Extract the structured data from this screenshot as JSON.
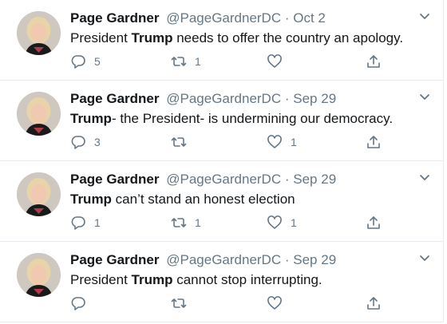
{
  "tweets": [
    {
      "name": "Page Gardner",
      "handle": "@PageGardnerDC",
      "separator": "·",
      "date": "Oct 2",
      "text_before": "President ",
      "text_bold": "Trump",
      "text_after": " needs to offer the country an apology.",
      "replies": "5",
      "retweets": "1",
      "likes": ""
    },
    {
      "name": "Page Gardner",
      "handle": "@PageGardnerDC",
      "separator": "·",
      "date": "Sep 29",
      "text_before": "",
      "text_bold": "Trump",
      "text_after": "- the President- is undermining our democracy.",
      "replies": "3",
      "retweets": "",
      "likes": "1"
    },
    {
      "name": "Page Gardner",
      "handle": "@PageGardnerDC",
      "separator": "·",
      "date": "Sep 29",
      "text_before": "",
      "text_bold": "Trump",
      "text_after": " can’t stand an honest election",
      "replies": "1",
      "retweets": "1",
      "likes": "1"
    },
    {
      "name": "Page Gardner",
      "handle": "@PageGardnerDC",
      "separator": "·",
      "date": "Sep 29",
      "text_before": "President ",
      "text_bold": "Trump",
      "text_after": " cannot stop interrupting.",
      "replies": "",
      "retweets": "",
      "likes": ""
    }
  ],
  "icons": [
    "avatar-photo",
    "chevron-down-icon",
    "reply-icon",
    "retweet-icon",
    "like-icon",
    "share-icon"
  ],
  "colors": {
    "text": "#14171a",
    "secondary": "#657786",
    "divider": "#e6ecf0"
  }
}
